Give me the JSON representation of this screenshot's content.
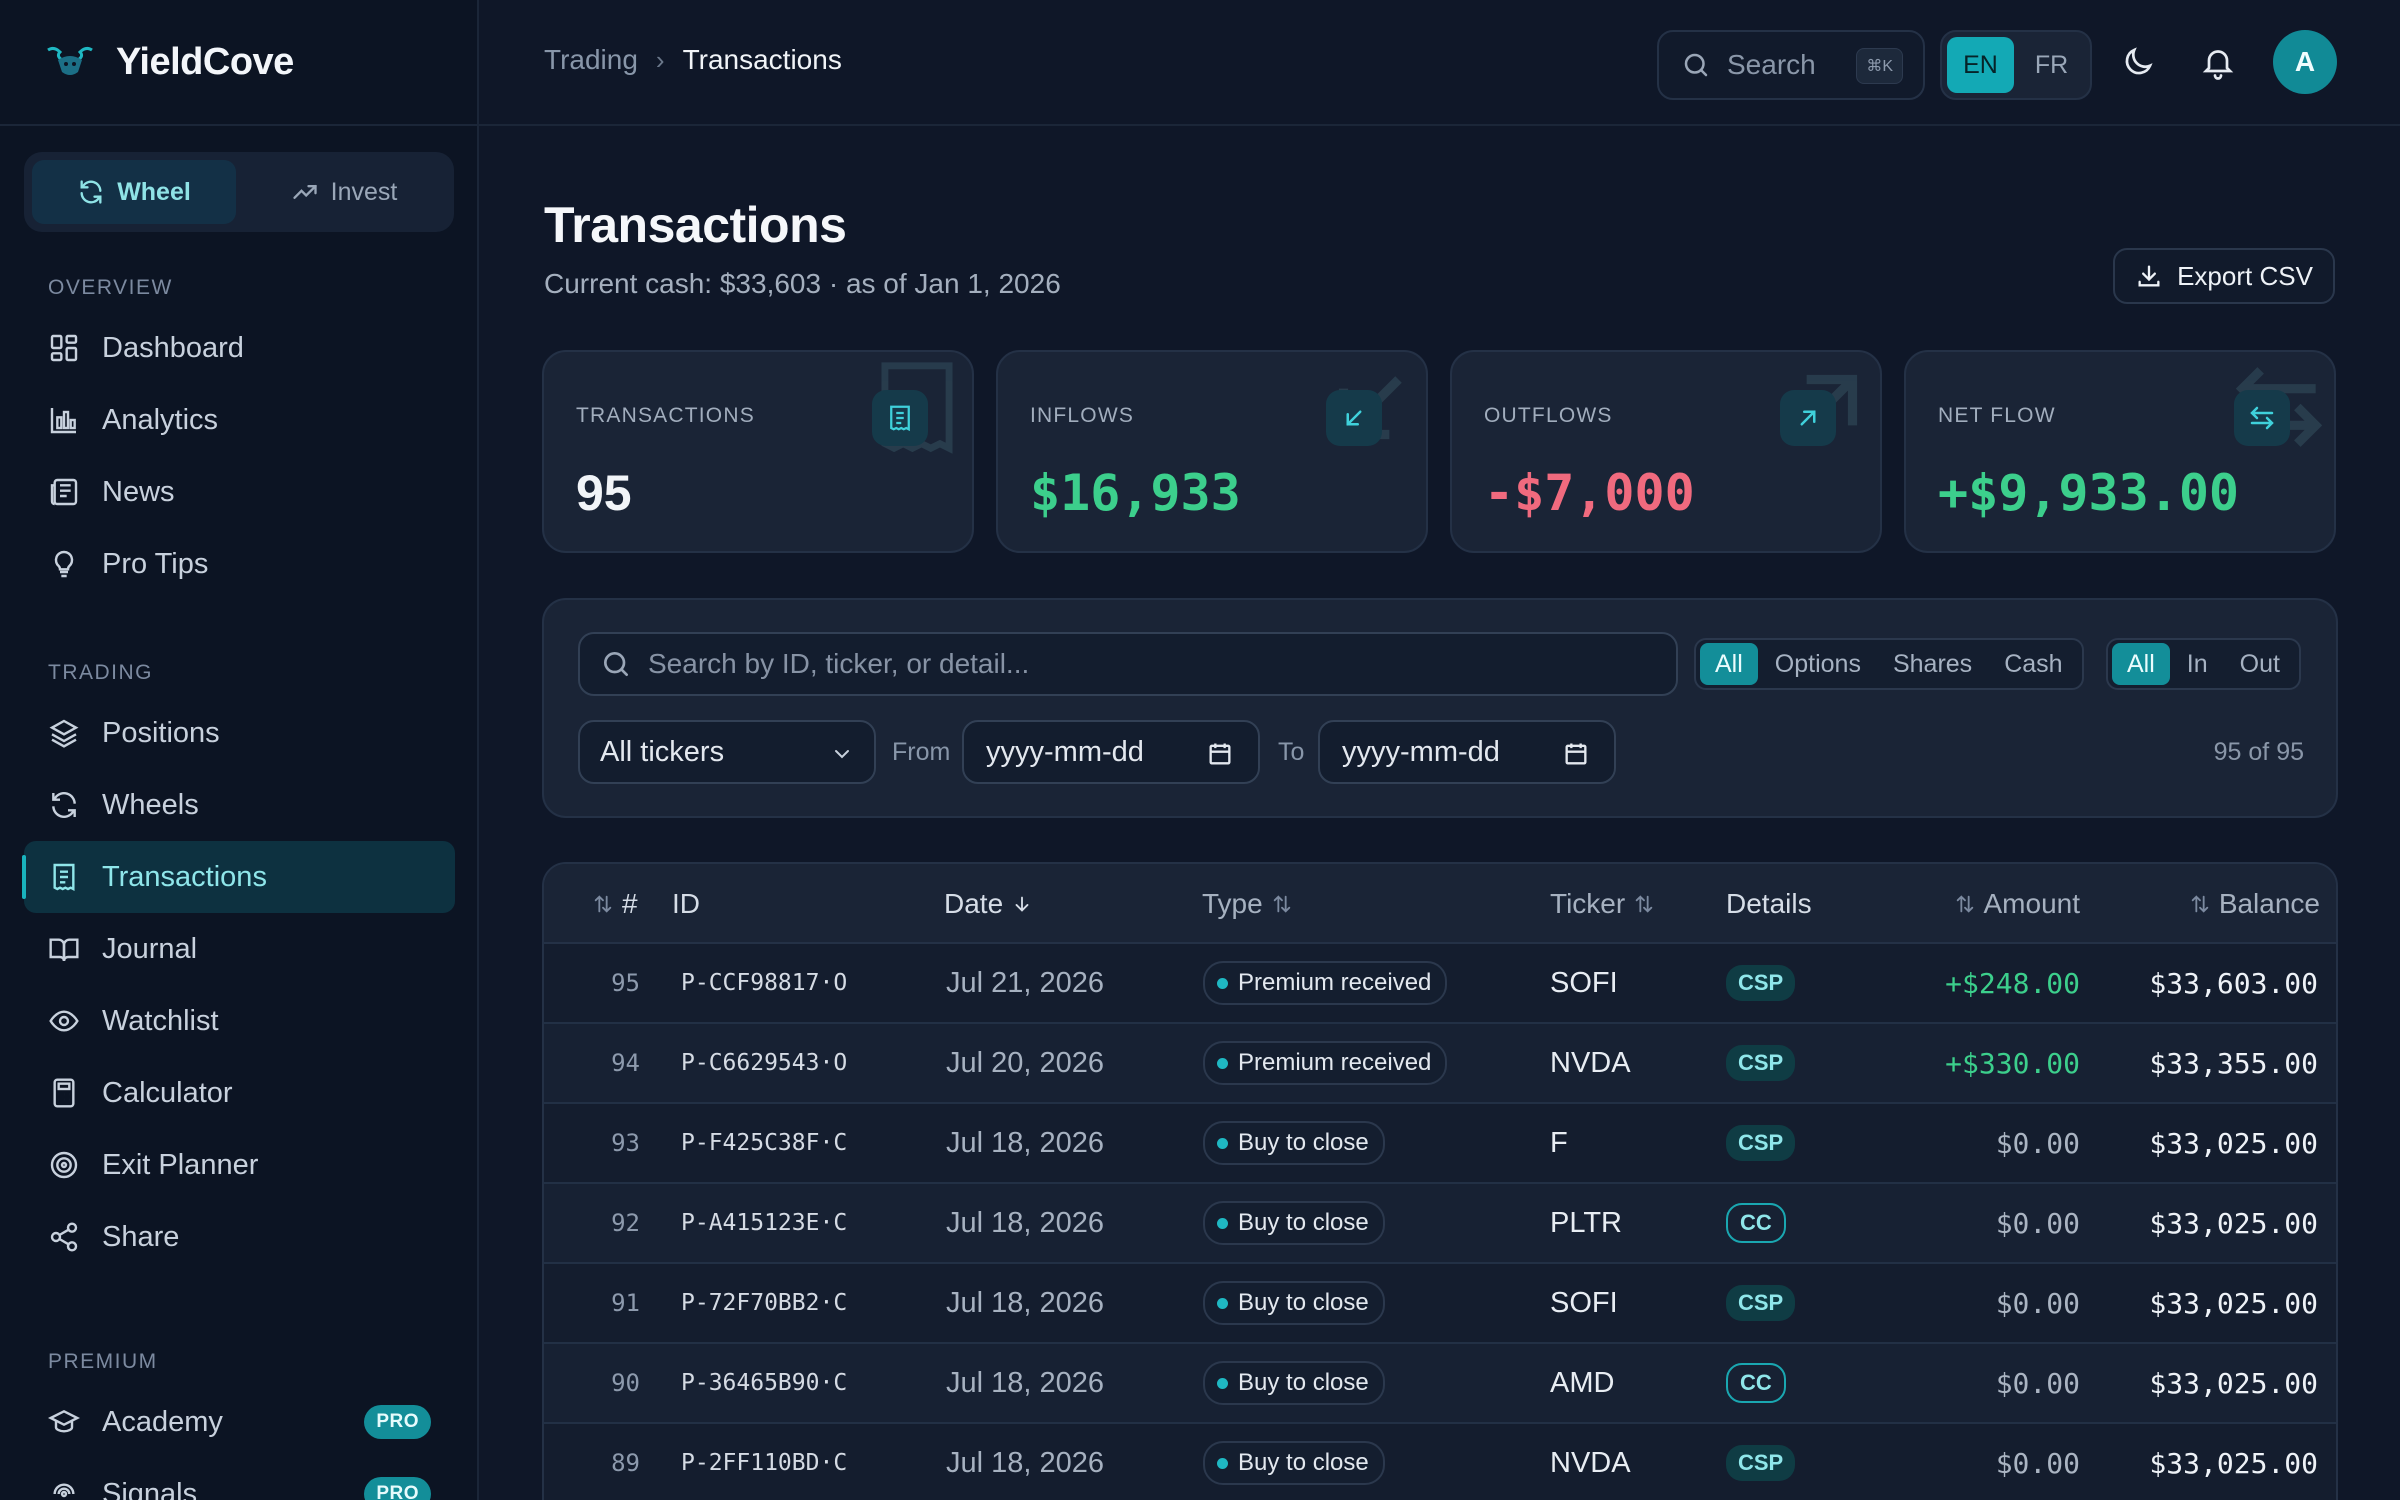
{
  "app": {
    "name": "YieldCove"
  },
  "mode_switch": [
    {
      "label": "Wheel",
      "icon": "refresh-icon",
      "active": true
    },
    {
      "label": "Invest",
      "icon": "trending-up-icon",
      "active": false
    }
  ],
  "sidebar": {
    "overview": {
      "heading": "OVERVIEW",
      "items": [
        {
          "label": "Dashboard",
          "icon": "dashboard-icon"
        },
        {
          "label": "Analytics",
          "icon": "bar-chart-icon"
        },
        {
          "label": "News",
          "icon": "newspaper-icon"
        },
        {
          "label": "Pro Tips",
          "icon": "lightbulb-icon"
        }
      ]
    },
    "trading": {
      "heading": "TRADING",
      "items": [
        {
          "label": "Positions",
          "icon": "layers-icon"
        },
        {
          "label": "Wheels",
          "icon": "refresh-icon"
        },
        {
          "label": "Transactions",
          "icon": "receipt-icon",
          "active": true
        },
        {
          "label": "Journal",
          "icon": "book-icon"
        },
        {
          "label": "Watchlist",
          "icon": "eye-icon"
        },
        {
          "label": "Calculator",
          "icon": "calculator-icon"
        },
        {
          "label": "Exit Planner",
          "icon": "target-icon"
        },
        {
          "label": "Share",
          "icon": "share-icon"
        }
      ]
    },
    "premium": {
      "heading": "PREMIUM",
      "items": [
        {
          "label": "Academy",
          "icon": "graduation-cap-icon",
          "badge": "PRO"
        },
        {
          "label": "Signals",
          "icon": "signal-icon",
          "badge": "PRO"
        }
      ]
    }
  },
  "topbar": {
    "breadcrumb": [
      "Trading",
      "Transactions"
    ],
    "search_label": "Search",
    "search_shortcut": "⌘K",
    "languages": [
      {
        "label": "EN",
        "active": true
      },
      {
        "label": "FR",
        "active": false
      }
    ],
    "avatar_initial": "A"
  },
  "page": {
    "title": "Transactions",
    "subtitle": "Current cash: $33,603 · as of Jan 1, 2026",
    "export_label": "Export CSV"
  },
  "stats": [
    {
      "label": "TRANSACTIONS",
      "value": "95",
      "tone": "neutral",
      "icon": "receipt-icon"
    },
    {
      "label": "INFLOWS",
      "value": "$16,933",
      "tone": "positive",
      "icon": "arrow-down-left-icon"
    },
    {
      "label": "OUTFLOWS",
      "value": "-$7,000",
      "tone": "negative",
      "icon": "arrow-up-right-icon"
    },
    {
      "label": "NET FLOW",
      "value": "+$9,933.00",
      "tone": "positive",
      "icon": "arrows-exchange-icon"
    }
  ],
  "colors": {
    "accent": "#13a9b5",
    "positive": "#3ccf8c",
    "negative": "#f06a7e",
    "neutral": "#f1f4f8"
  },
  "filters": {
    "search_placeholder": "Search by ID, ticker, or detail...",
    "kind_options": [
      {
        "label": "All",
        "active": true
      },
      {
        "label": "Options",
        "active": false
      },
      {
        "label": "Shares",
        "active": false
      },
      {
        "label": "Cash",
        "active": false
      }
    ],
    "direction_options": [
      {
        "label": "All",
        "active": true
      },
      {
        "label": "In",
        "active": false
      },
      {
        "label": "Out",
        "active": false
      }
    ],
    "ticker_select": "All tickers",
    "from_label": "From",
    "to_label": "To",
    "date_placeholder": "yyyy-mm-dd",
    "result_count": "95 of 95"
  },
  "table": {
    "columns": {
      "num": "#",
      "id": "ID",
      "date": "Date",
      "type": "Type",
      "ticker": "Ticker",
      "details": "Details",
      "amount": "Amount",
      "balance": "Balance"
    },
    "rows": [
      {
        "num": "95",
        "id": "P-CCF98817·O",
        "date": "Jul 21, 2026",
        "type": "Premium received",
        "ticker": "SOFI",
        "detail": "CSP",
        "amount": "+$248.00",
        "amount_tone": "positive",
        "balance": "$33,603.00"
      },
      {
        "num": "94",
        "id": "P-C6629543·O",
        "date": "Jul 20, 2026",
        "type": "Premium received",
        "ticker": "NVDA",
        "detail": "CSP",
        "amount": "+$330.00",
        "amount_tone": "positive",
        "balance": "$33,355.00"
      },
      {
        "num": "93",
        "id": "P-F425C38F·C",
        "date": "Jul 18, 2026",
        "type": "Buy to close",
        "ticker": "F",
        "detail": "CSP",
        "amount": "$0.00",
        "amount_tone": "zero",
        "balance": "$33,025.00"
      },
      {
        "num": "92",
        "id": "P-A415123E·C",
        "date": "Jul 18, 2026",
        "type": "Buy to close",
        "ticker": "PLTR",
        "detail": "CC",
        "amount": "$0.00",
        "amount_tone": "zero",
        "balance": "$33,025.00"
      },
      {
        "num": "91",
        "id": "P-72F70BB2·C",
        "date": "Jul 18, 2026",
        "type": "Buy to close",
        "ticker": "SOFI",
        "detail": "CSP",
        "amount": "$0.00",
        "amount_tone": "zero",
        "balance": "$33,025.00"
      },
      {
        "num": "90",
        "id": "P-36465B90·C",
        "date": "Jul 18, 2026",
        "type": "Buy to close",
        "ticker": "AMD",
        "detail": "CC",
        "amount": "$0.00",
        "amount_tone": "zero",
        "balance": "$33,025.00"
      },
      {
        "num": "89",
        "id": "P-2FF110BD·C",
        "date": "Jul 18, 2026",
        "type": "Buy to close",
        "ticker": "NVDA",
        "detail": "CSP",
        "amount": "$0.00",
        "amount_tone": "zero",
        "balance": "$33,025.00"
      }
    ]
  }
}
